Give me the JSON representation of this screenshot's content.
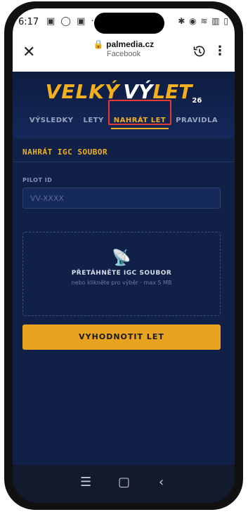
{
  "status_bar": {
    "time": "6:17",
    "left_icons": "▣ ◯ ▣ ·",
    "right_icons": "✱ ◉ ≋ ▥ ▯"
  },
  "browser": {
    "domain": "palmedia.cz",
    "source": "Facebook"
  },
  "site": {
    "logo_part1": "VELKÝ",
    "logo_part2": "VÝ",
    "logo_part3": "LET",
    "logo_num": "26",
    "nav": [
      "VÝSLEDKY",
      "LETY",
      "NAHRÁT LET",
      "PRAVIDLA"
    ],
    "active_nav": "NAHRÁT LET"
  },
  "form": {
    "section_title": "NAHRÁT IGC SOUBOR",
    "pilot_label": "PILOT ID",
    "pilot_placeholder": "VV-XXXX",
    "dropzone_title": "PŘETÁHNĚTE IGC SOUBOR",
    "dropzone_sub": "nebo klikněte pro výběr · max 5 MB",
    "submit_label": "VYHODNOTIT LET"
  },
  "colors": {
    "accent": "#f2b01e",
    "background": "#102046",
    "highlight": "#e53935"
  }
}
